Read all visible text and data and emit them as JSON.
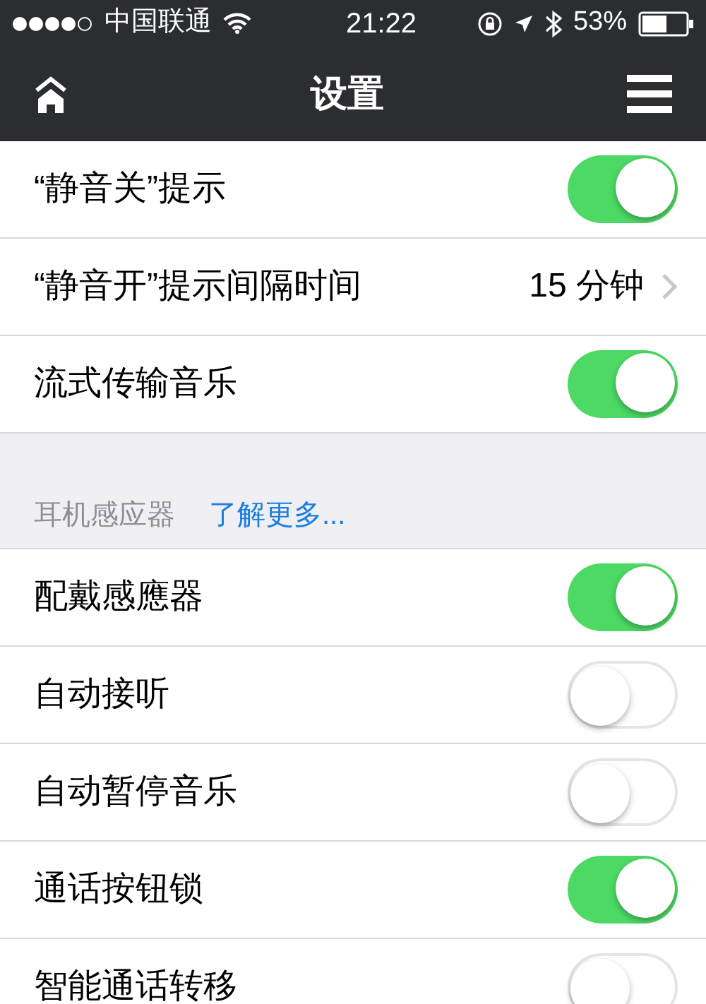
{
  "status_bar": {
    "carrier": "中国联通",
    "time": "21:22",
    "battery": "53%"
  },
  "nav": {
    "title": "设置"
  },
  "groups": [
    {
      "items": [
        {
          "kind": "toggle",
          "label": "“静音关”提示",
          "on": true
        },
        {
          "kind": "value",
          "label": "“静音开”提示间隔时间",
          "value": "15 分钟"
        },
        {
          "kind": "toggle",
          "label": "流式传输音乐",
          "on": true
        }
      ]
    },
    {
      "header": "耳机感应器",
      "link": "了解更多...",
      "items": [
        {
          "kind": "toggle",
          "label": "配戴感應器",
          "on": true
        },
        {
          "kind": "toggle",
          "label": "自动接听",
          "on": false
        },
        {
          "kind": "toggle",
          "label": "自动暂停音乐",
          "on": false
        },
        {
          "kind": "toggle",
          "label": "通话按钮锁",
          "on": true
        },
        {
          "kind": "toggle",
          "label": "智能通话转移",
          "on": false
        }
      ]
    }
  ]
}
